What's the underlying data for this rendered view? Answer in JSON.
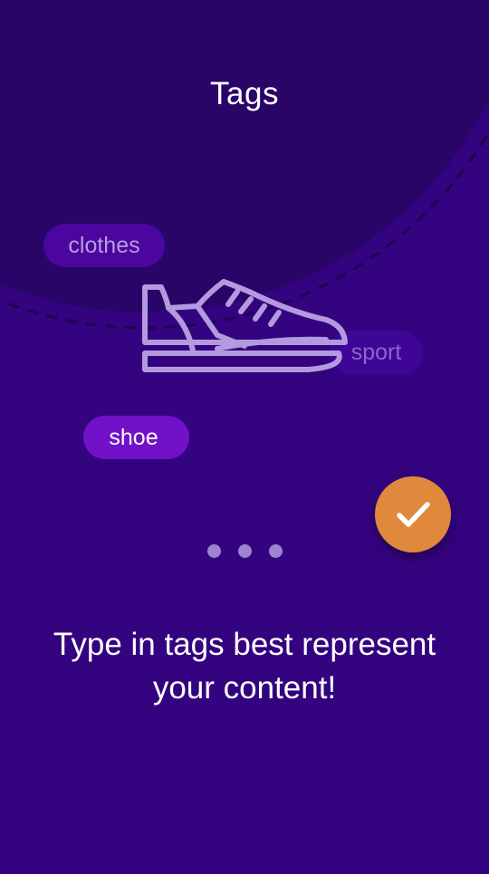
{
  "header": {
    "title": "Tags"
  },
  "illustration": {
    "icon": "sneaker-icon",
    "tags": [
      {
        "label": "clothes"
      },
      {
        "label": "sport"
      },
      {
        "label": "shoe"
      }
    ]
  },
  "pager": {
    "pages": 3
  },
  "fab": {
    "icon": "check-icon"
  },
  "content": {
    "line1": "Type in tags best represent",
    "line2": "your content!"
  },
  "colors": {
    "background": "#34037f",
    "circle": "#290568",
    "tag_selected": "#7111c8",
    "fab": "#e0893c"
  }
}
